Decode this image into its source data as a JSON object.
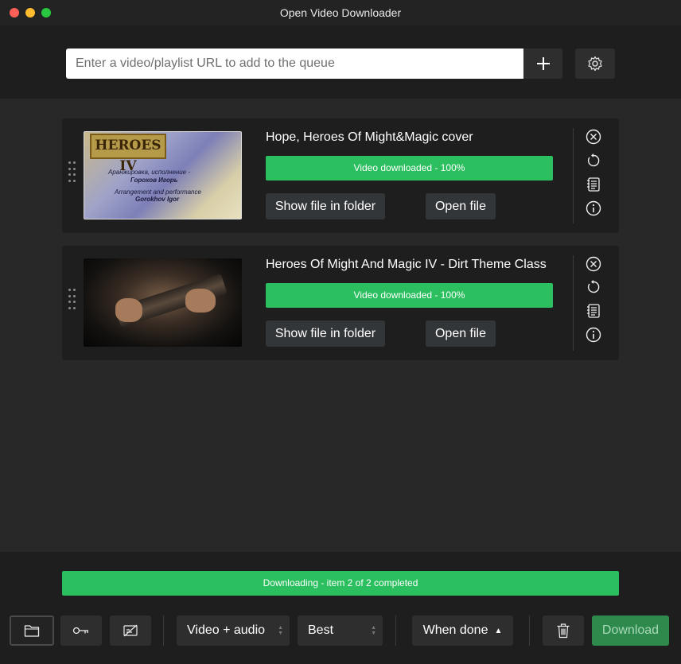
{
  "window": {
    "title": "Open Video Downloader"
  },
  "topbar": {
    "url_placeholder": "Enter a video/playlist URL to add to the queue",
    "add_icon": "plus-icon",
    "settings_icon": "gear-icon"
  },
  "queue": {
    "items": [
      {
        "title": "Hope, Heroes Of Might&Magic cover",
        "progress_label": "Video downloaded - 100%",
        "progress": 1.0,
        "show_folder_label": "Show file in folder",
        "open_file_label": "Open file",
        "thumb_logo": "HEROES IV",
        "thumb_caption": [
          "Аранжировка, исполнение -",
          "Горохов Игорь",
          "Arrangement and performance",
          "Gorokhov Igor"
        ]
      },
      {
        "title": "Heroes Of Might And Magic IV - Dirt Theme Class",
        "progress_label": "Video downloaded - 100%",
        "progress": 1.0,
        "show_folder_label": "Show file in folder",
        "open_file_label": "Open file"
      }
    ]
  },
  "footer": {
    "total_progress_label": "Downloading - item 2 of 2 completed",
    "format_select": "Video + audio",
    "quality_select": "Best",
    "when_done_label": "When done",
    "download_label": "Download",
    "colors": {
      "accent_green": "#2bbf5f",
      "download_green": "#2e8a4c"
    }
  }
}
